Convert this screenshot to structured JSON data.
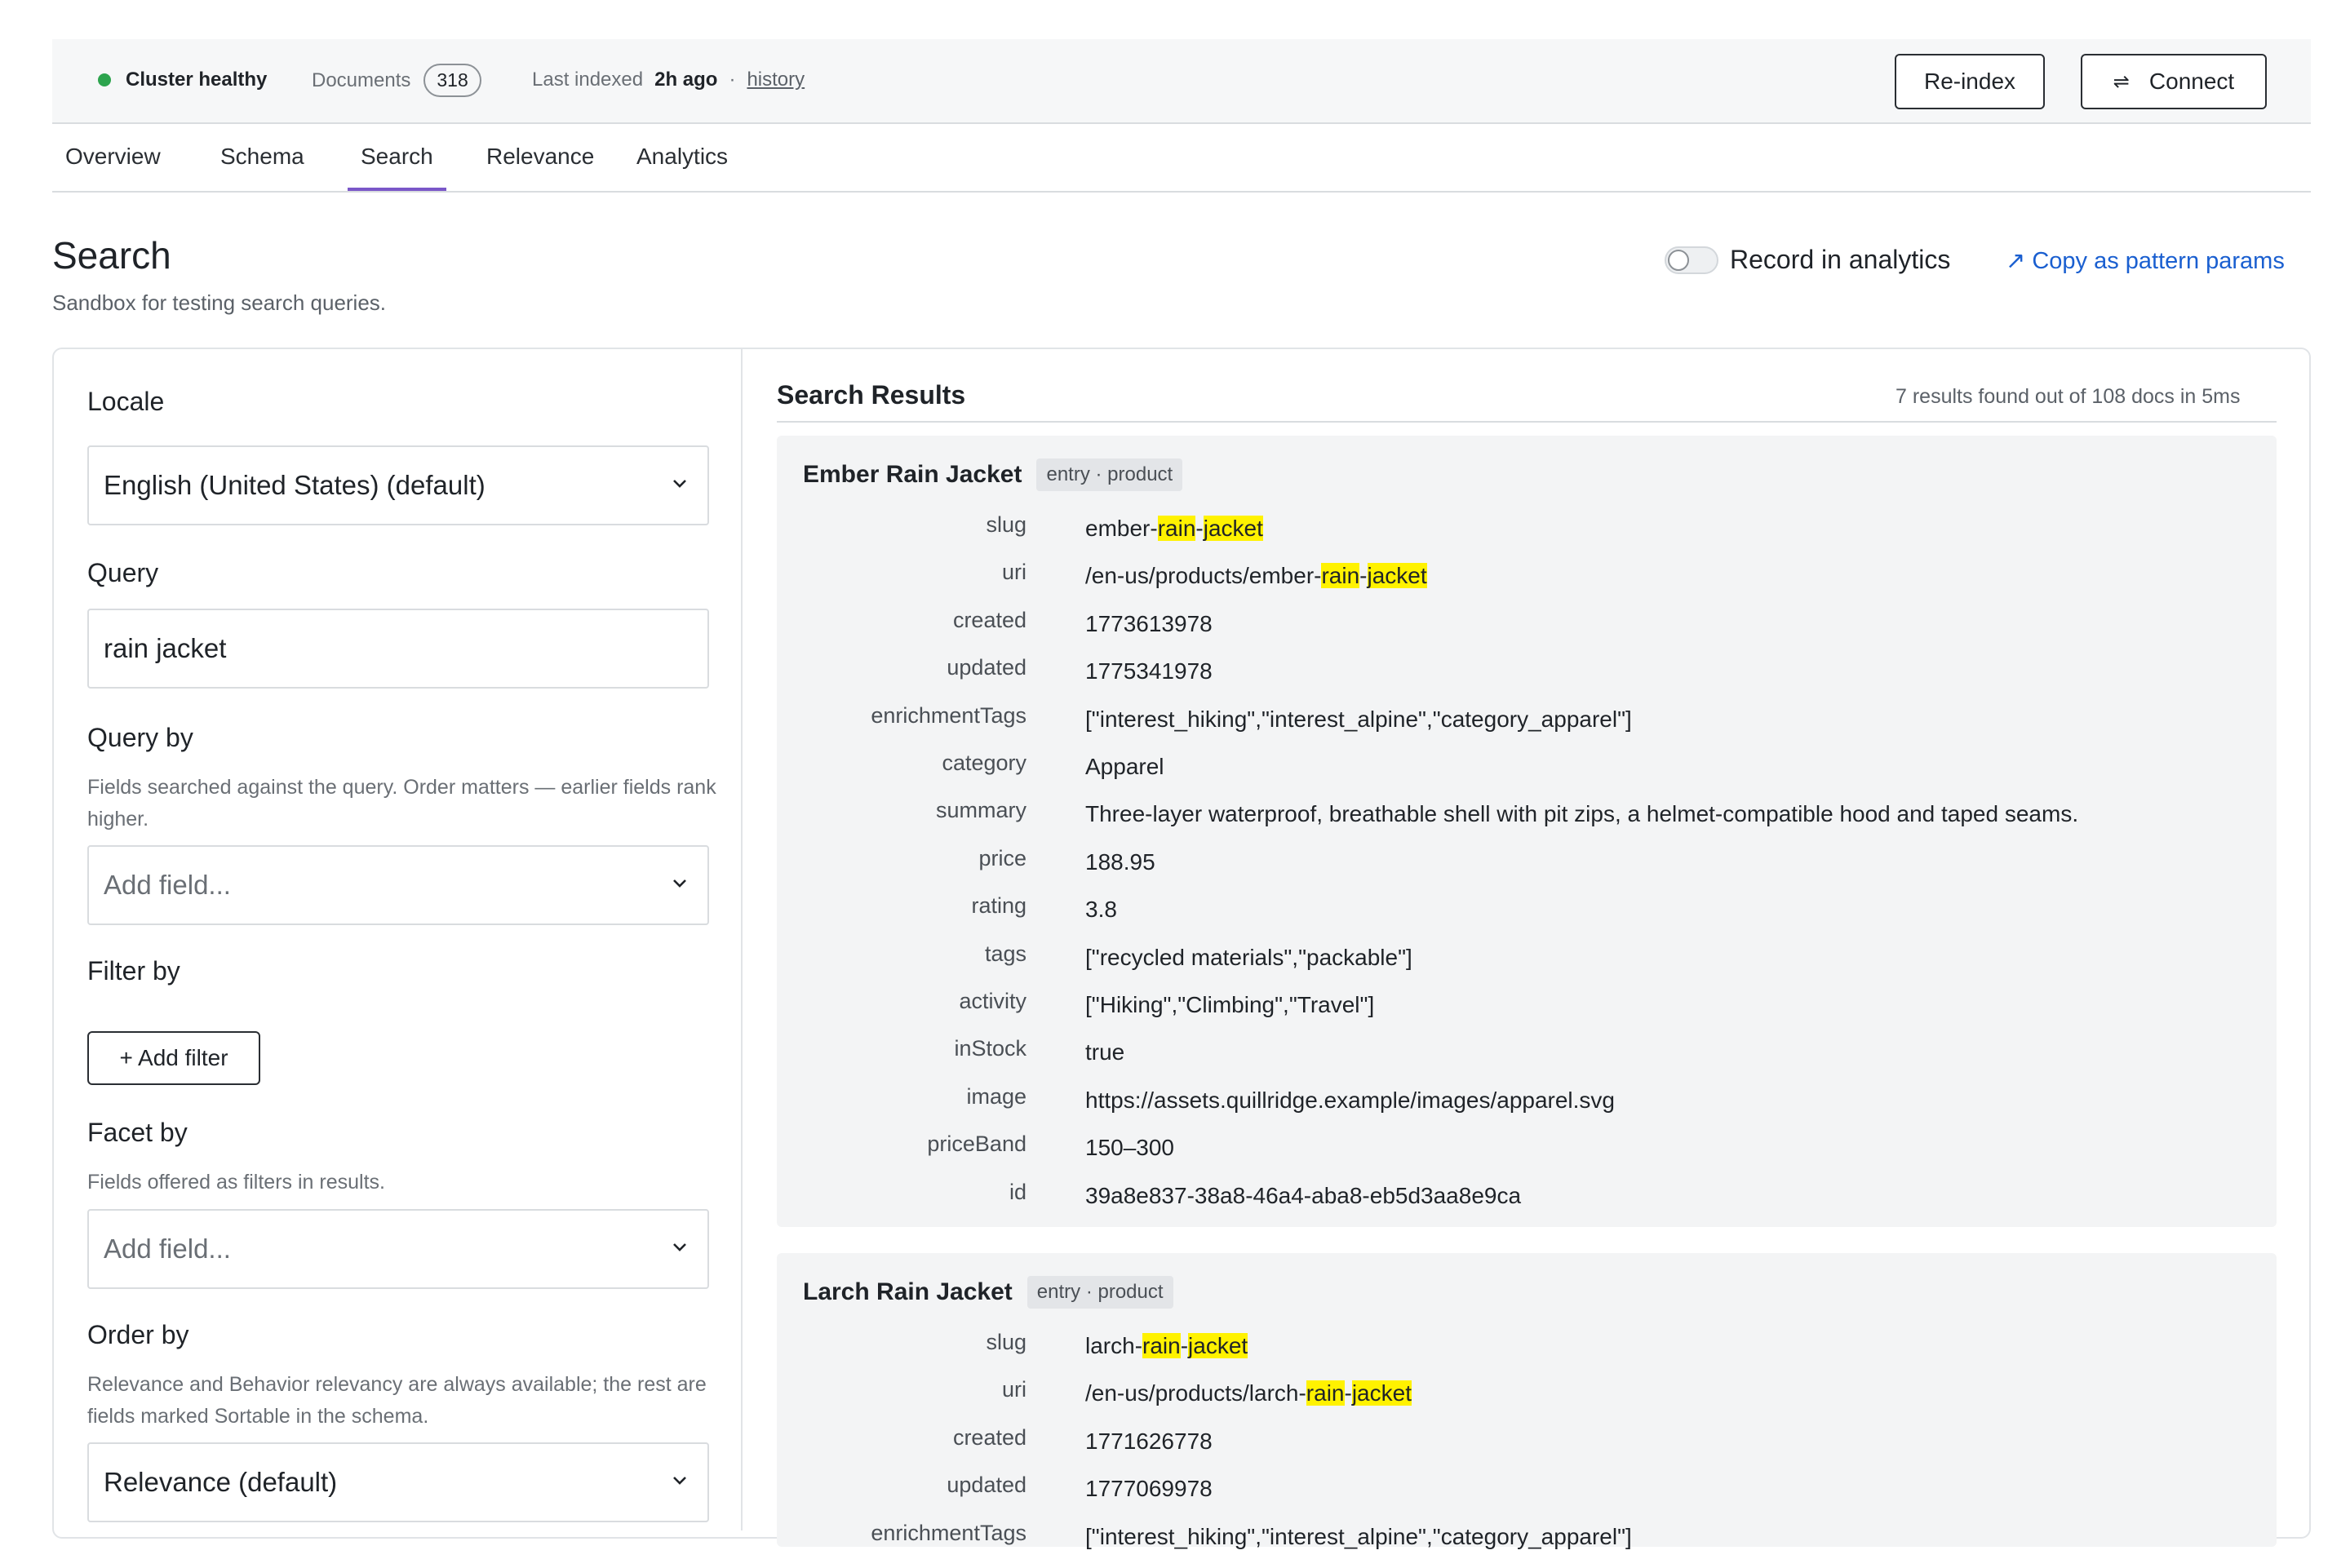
{
  "header": {
    "status_label": "Cluster healthy",
    "status_color": "#2da44e",
    "documents_label": "Documents",
    "documents_count": "318",
    "last_indexed_label": "Last indexed",
    "last_indexed_value": "2h ago",
    "separator": "·",
    "history_link": "history",
    "reindex_label": "Re-index",
    "connect_icon": "⇌",
    "connect_label": "Connect"
  },
  "tabs": [
    {
      "label": "Overview"
    },
    {
      "label": "Schema"
    },
    {
      "label": "Search",
      "active": true
    },
    {
      "label": "Relevance"
    },
    {
      "label": "Analytics"
    }
  ],
  "page": {
    "title": "Search",
    "subtitle": "Sandbox for testing search queries.",
    "record_label": "Record in analytics",
    "record_enabled": false,
    "copy_label": "↗ Copy as pattern params",
    "accent_color": "#7a57c8",
    "link_color": "#1a5fd0"
  },
  "form": {
    "locale": {
      "label": "Locale",
      "value": "English (United States) (default)"
    },
    "query": {
      "label": "Query",
      "value": "rain jacket"
    },
    "query_by": {
      "label": "Query by",
      "help": "Fields searched against the query. Order matters — earlier fields rank higher.",
      "placeholder": "Add field..."
    },
    "filter_by": {
      "label": "Filter by",
      "button": "+ Add filter"
    },
    "facet_by": {
      "label": "Facet by",
      "help": "Fields offered as filters in results.",
      "placeholder": "Add field..."
    },
    "order_by": {
      "label": "Order by",
      "help": "Relevance and Behavior relevancy are always available; the rest are fields marked Sortable in the schema.",
      "value": "Relevance (default)"
    }
  },
  "results": {
    "title": "Search Results",
    "meta": "7 results found out of 108 docs in 5ms",
    "highlight_color": "#fff200",
    "items": [
      {
        "title": "Ember Rain Jacket",
        "badge": "entry · product",
        "fields": [
          {
            "key": "slug",
            "parts": [
              "ember-",
              "rain",
              "-",
              "jacket"
            ]
          },
          {
            "key": "uri",
            "parts": [
              "/en-us/products/ember-",
              "rain",
              "-",
              "jacket"
            ]
          },
          {
            "key": "created",
            "value": "1773613978"
          },
          {
            "key": "updated",
            "value": "1775341978"
          },
          {
            "key": "enrichmentTags",
            "value": "[\"interest_hiking\",\"interest_alpine\",\"category_apparel\"]"
          },
          {
            "key": "category",
            "value": "Apparel"
          },
          {
            "key": "summary",
            "value": "Three-layer waterproof, breathable shell with pit zips, a helmet-compatible hood and taped seams."
          },
          {
            "key": "price",
            "value": "188.95"
          },
          {
            "key": "rating",
            "value": "3.8"
          },
          {
            "key": "tags",
            "value": "[\"recycled materials\",\"packable\"]"
          },
          {
            "key": "activity",
            "value": "[\"Hiking\",\"Climbing\",\"Travel\"]"
          },
          {
            "key": "inStock",
            "value": "true"
          },
          {
            "key": "image",
            "value": "https://assets.quillridge.example/images/apparel.svg"
          },
          {
            "key": "priceBand",
            "value": "150–300"
          },
          {
            "key": "id",
            "value": "39a8e837-38a8-46a4-aba8-eb5d3aa8e9ca"
          }
        ]
      },
      {
        "title": "Larch Rain Jacket",
        "badge": "entry · product",
        "fields": [
          {
            "key": "slug",
            "parts": [
              "larch-",
              "rain",
              "-",
              "jacket"
            ]
          },
          {
            "key": "uri",
            "parts": [
              "/en-us/products/larch-",
              "rain",
              "-",
              "jacket"
            ]
          },
          {
            "key": "created",
            "value": "1771626778"
          },
          {
            "key": "updated",
            "value": "1777069978"
          },
          {
            "key": "enrichmentTags",
            "value": "[\"interest_hiking\",\"interest_alpine\",\"category_apparel\"]"
          }
        ]
      }
    ]
  }
}
